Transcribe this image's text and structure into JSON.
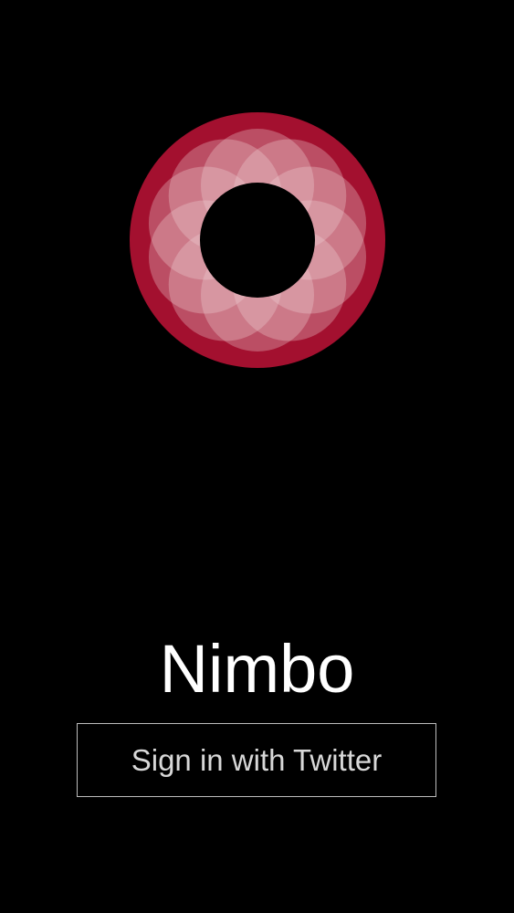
{
  "app": {
    "name": "Nimbo"
  },
  "logo": {
    "icon": "flower-ring-icon",
    "colors": {
      "ring": "#a3102f",
      "petal": "#f0d2d8",
      "center": "#000000"
    },
    "petal_count": 10
  },
  "signin": {
    "label": "Sign in with Twitter"
  }
}
